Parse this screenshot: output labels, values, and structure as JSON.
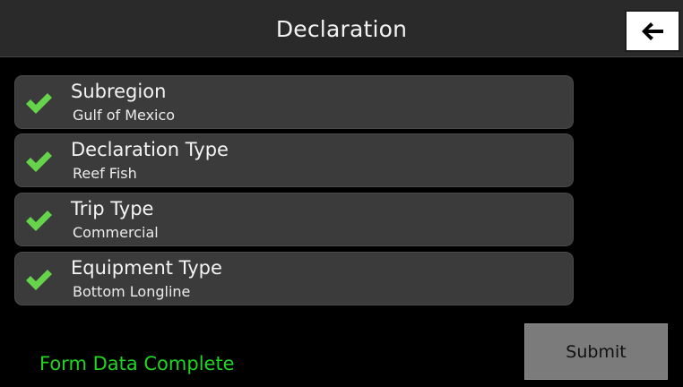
{
  "header": {
    "title": "Declaration",
    "back_icon": "arrow-left-icon"
  },
  "fields": [
    {
      "label": "Subregion",
      "value": "Gulf of Mexico",
      "status_icon": "checkmark-icon"
    },
    {
      "label": "Declaration Type",
      "value": "Reef Fish",
      "status_icon": "checkmark-icon"
    },
    {
      "label": "Trip Type",
      "value": "Commercial",
      "status_icon": "checkmark-icon"
    },
    {
      "label": "Equipment Type",
      "value": "Bottom Longline",
      "status_icon": "checkmark-icon"
    }
  ],
  "footer": {
    "status": "Form Data Complete",
    "submit_label": "Submit"
  },
  "colors": {
    "background": "#000000",
    "header": "#2a2a2a",
    "row": "#3a3b3a",
    "check": "#66d44a",
    "status_text": "#22d422",
    "submit": "#7a7b7a"
  }
}
